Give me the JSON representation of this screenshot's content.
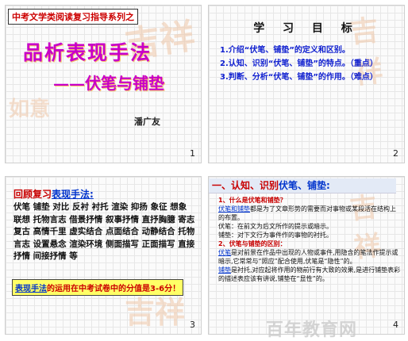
{
  "slides": [
    {
      "series": "中考文学类阅读复习指导系列之",
      "title": "品析表现手法",
      "subtitle": "——伏笔与铺垫",
      "author": "潘广友",
      "page": "1"
    },
    {
      "title": "学 习 目 标",
      "goals": [
        "1.介绍“伏笔、铺垫”的定义和区别。",
        "2.认知、识别“伏笔、铺垫”的特点。（重点）",
        "3.判断、分析“伏笔、铺垫”的作用。（难点）"
      ],
      "page": "2"
    },
    {
      "review_prefix": "回顾复习",
      "review_topic": "表现手法:",
      "methods": "伏笔 铺垫 对比 反衬 衬托 渲染 抑扬 象征 想象 联想 托物言志 借景抒情 叙事抒情 直抒胸臆 寄志复古 高情千里 虚实结合 点面结合 动静结合 托物言志 设置悬念 渲染环境 侧面描写 正面描写 直接抒情 间接抒情 等",
      "score_prefix": "表现手法",
      "score_text": "的运用在中考试卷中的分值是3-6分！",
      "page": "3"
    },
    {
      "heading_prefix": "一、认知、识别",
      "heading_topic": "伏笔、铺垫:",
      "lines": [
        {
          "type": "q",
          "text": "1、什么是伏笔和铺垫？"
        },
        {
          "type": "hl",
          "text": "伏笔和铺垫",
          "rest": "都是为了文章形势的需要而对事物或某段活在结构上的布置。"
        },
        {
          "type": "p",
          "text": "伏笔：在前文为后文所作的提示或暗示。"
        },
        {
          "type": "p",
          "text": "铺垫：对下文行为事件作的事物的衬托。"
        },
        {
          "type": "q",
          "text": "2、伏笔与铺垫的区别："
        },
        {
          "type": "hl",
          "text": "伏笔",
          "rest": "是对前景在作品中出现的人物或事件,用隐含的笔法作提示或暗示,它常常与“照应”配合使用,伏笔是“隐性”的。"
        },
        {
          "type": "hl",
          "text": "铺垫",
          "rest": "是衬托,对应起将作用的物前行有大致的效果,是进行铺垫表彩的描述表应该有讲说,铺垫在“显性”的。"
        }
      ],
      "page": "4"
    }
  ],
  "watermark": "百年教育网",
  "seal_text": "吉祥如意",
  "colors": {
    "title_magenta": "#c800c8",
    "accent_red": "#c80000",
    "accent_blue": "#0033cc",
    "highlight_yellow": "#ffff66"
  }
}
